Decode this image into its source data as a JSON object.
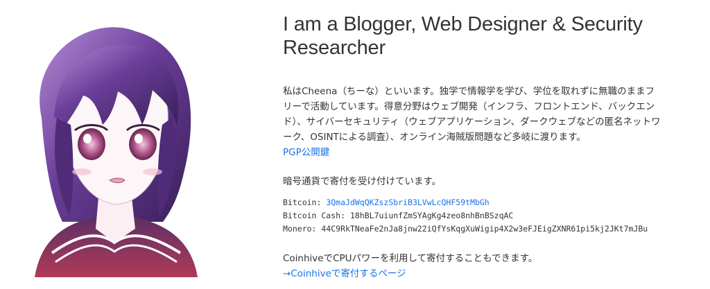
{
  "header": {
    "headline": "I am a Blogger, Web Designer & Security Researcher"
  },
  "bio": {
    "text": "私はCheena（ちーな）といいます。独学で情報学を学び、学位を取れずに無職のままフリーで活動しています。得意分野はウェブ開発（インフラ、フロントエンド、バックエンド）、サイバーセキュリティ（ウェブアプリケーション、ダークウェブなどの匿名ネットワーク、OSINTによる調査）、オンライン海賊版問題など多岐に渡ります。",
    "pgp_link": "PGP公開鍵"
  },
  "donation": {
    "intro": "暗号通貨で寄付を受け付けています。",
    "wallets": [
      {
        "label": "Bitcoin:",
        "address": "3QmaJdWqQKZszSbriB3LVwLcQHF59tMbGh"
      },
      {
        "label": "Bitcoin Cash:",
        "address": "18hBL7uiunfZmSYAgKg4zeo8nhBnBSzqAC"
      },
      {
        "label": "Monero:",
        "address": "44C9RkTNeaFe2nJa8jnw22iQfYsKqgXuWigip4X2w3eFJEigZXNR61pi5kj2JKt7mJBu"
      }
    ],
    "coinhive_text": "CoinhiveでCPUパワーを利用して寄付することもできます。",
    "coinhive_link": "→Coinhiveで寄付するページ"
  },
  "colors": {
    "link": "#1a73e8",
    "text": "#333333",
    "hair_dark": "#4a2a6e",
    "hair_light": "#9a5fc4"
  },
  "icons": {
    "avatar": "anime-girl-avatar"
  }
}
